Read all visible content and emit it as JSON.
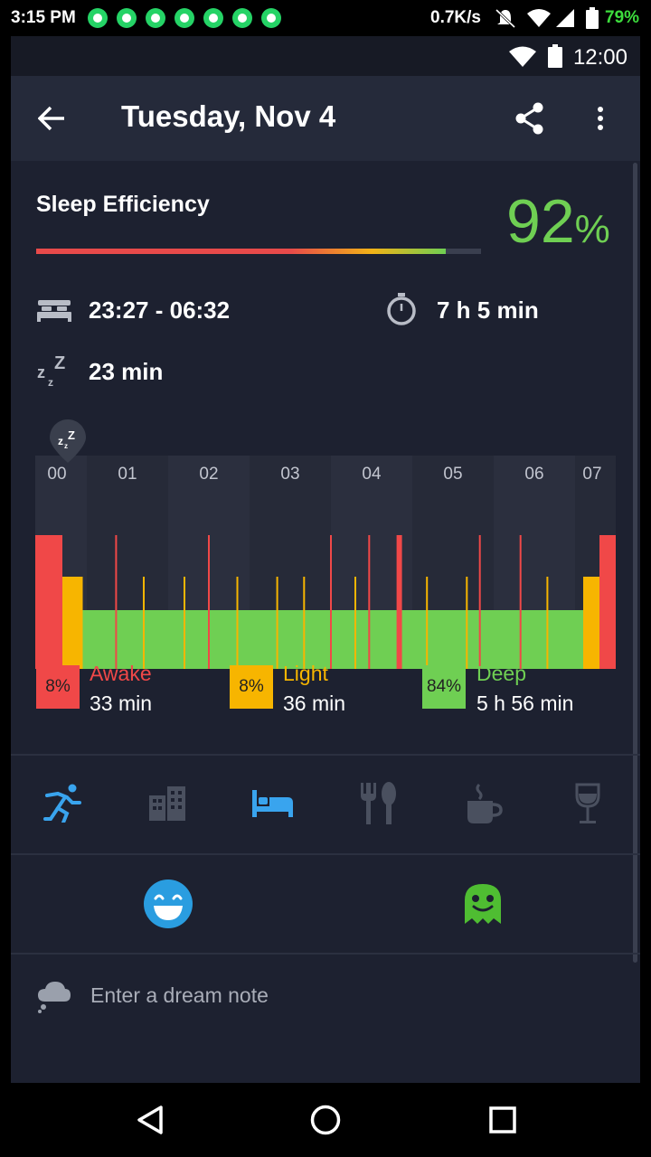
{
  "status_bar": {
    "time": "3:15 PM",
    "net_speed": "0.7K/s",
    "battery": "79%",
    "notification_count": 7
  },
  "inner_status": {
    "time": "12:00"
  },
  "toolbar": {
    "title": "Tuesday, Nov 4"
  },
  "efficiency": {
    "label": "Sleep Efficiency",
    "value": "92",
    "unit": "%",
    "fraction": 0.92
  },
  "summary": {
    "time_range": "23:27 - 06:32",
    "duration": "7 h 5 min",
    "snore": "23 min"
  },
  "chart_data": {
    "type": "bar",
    "x": [
      "00",
      "01",
      "02",
      "03",
      "04",
      "05",
      "06",
      "07"
    ],
    "series": [
      {
        "name": "Awake",
        "values": []
      },
      {
        "name": "Light",
        "values": []
      },
      {
        "name": "Deep",
        "values": []
      }
    ],
    "segments": [
      {
        "stage": "awake",
        "start": 0.0,
        "end": 0.2
      },
      {
        "stage": "light",
        "start": 0.2,
        "end": 0.45
      },
      {
        "stage": "deep",
        "start": 0.45,
        "end": 6.6
      },
      {
        "stage": "light",
        "start": 6.6,
        "end": 6.8
      },
      {
        "stage": "awake",
        "start": 6.8,
        "end": 7.0
      }
    ],
    "spikes": [
      {
        "stage": "awake",
        "t": 0.86
      },
      {
        "stage": "light",
        "t": 1.2
      },
      {
        "stage": "light",
        "t": 1.7
      },
      {
        "stage": "awake",
        "t": 2.0
      },
      {
        "stage": "light",
        "t": 2.35
      },
      {
        "stage": "light",
        "t": 2.84
      },
      {
        "stage": "light",
        "t": 3.17
      },
      {
        "stage": "awake",
        "t": 3.5
      },
      {
        "stage": "light",
        "t": 3.8
      },
      {
        "stage": "awake",
        "t": 3.97
      },
      {
        "stage": "awake",
        "t": 4.35
      },
      {
        "stage": "light",
        "t": 4.68
      },
      {
        "stage": "light",
        "t": 5.17
      },
      {
        "stage": "awake",
        "t": 5.33
      },
      {
        "stage": "awake",
        "t": 5.83
      },
      {
        "stage": "light",
        "t": 6.16
      }
    ],
    "xlim": [
      0,
      7
    ],
    "awake_bold_marker_t": 4.34
  },
  "legend": [
    {
      "name": "Awake",
      "percent": "8%",
      "duration": "33 min",
      "color": "#f04848"
    },
    {
      "name": "Light",
      "percent": "8%",
      "duration": "36 min",
      "color": "#f7b500"
    },
    {
      "name": "Deep",
      "percent": "84%",
      "duration": "5 h 56 min",
      "color": "#6fcf53"
    }
  ],
  "tags": [
    {
      "icon": "running-icon",
      "active": true
    },
    {
      "icon": "building-icon",
      "active": false
    },
    {
      "icon": "bed-icon",
      "active": true
    },
    {
      "icon": "food-icon",
      "active": false
    },
    {
      "icon": "coffee-icon",
      "active": false
    },
    {
      "icon": "wine-icon",
      "active": false
    }
  ],
  "moods": [
    {
      "icon": "smiley-face-icon",
      "color": "#2a9de0"
    },
    {
      "icon": "ghost-monster-icon",
      "color": "#4fbd32"
    }
  ],
  "dream": {
    "placeholder": "Enter a dream note"
  },
  "colors": {
    "awake": "#f04848",
    "light": "#f7b500",
    "deep": "#6fcf53",
    "accent": "#39a4ee"
  }
}
